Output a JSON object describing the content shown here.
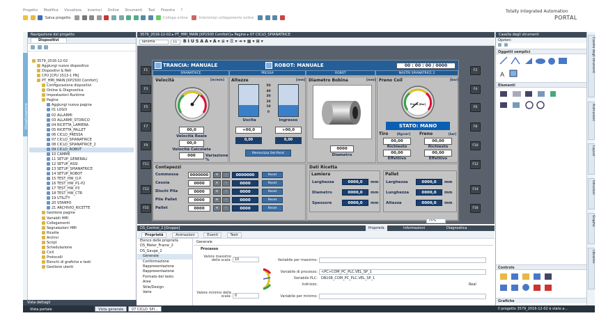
{
  "menubar": [
    "Progetto",
    "Modifica",
    "Visualizza",
    "Inserisci",
    "Online",
    "Strumenti",
    "Tool",
    "Finestra",
    "?"
  ],
  "brand": {
    "line1": "Totally Integrated Automation",
    "line2": "PORTAL"
  },
  "toolbar": {
    "save": "Salva progetto",
    "go_online": "Collega online",
    "go_offline": "Interrompi collegamento online"
  },
  "project_nav": {
    "header": "Navigazione del progetto",
    "tab": "Dispositivi",
    "items": [
      {
        "label": "3579_2016-12-02",
        "level": 0
      },
      {
        "label": "Aggiungi nuovo dispositivo",
        "level": 1
      },
      {
        "label": "Dispositivi & Reti",
        "level": 1
      },
      {
        "label": "CPU [CPU 1513-1 PN]",
        "level": 1
      },
      {
        "label": "PT_HMI_MAIN [KP1500 Comfort]",
        "level": 1
      },
      {
        "label": "Configurazione dispositivi",
        "level": 2
      },
      {
        "label": "Online & Diagnostica",
        "level": 2
      },
      {
        "label": "Impostazioni Runtime",
        "level": 2
      },
      {
        "label": "Pagine",
        "level": 2
      },
      {
        "label": "Aggiungi nuova pagina",
        "level": 3
      },
      {
        "label": "01 LOGO",
        "level": 3
      },
      {
        "label": "02 ALLARMI",
        "level": 3
      },
      {
        "label": "03 ALLARMI_STORICO",
        "level": 3
      },
      {
        "label": "04 RICETTA_LAMIERA",
        "level": 3
      },
      {
        "label": "05 RICETTA_PALLET",
        "level": 3
      },
      {
        "label": "06 CICLO_PRESSA",
        "level": 3
      },
      {
        "label": "07 CICLO_SPIANATRICE",
        "level": 3
      },
      {
        "label": "08 CICLO_SPIANATRICE_2",
        "level": 3
      },
      {
        "label": "09 CICLO_ROBOT",
        "level": 3
      },
      {
        "label": "10 CAMME",
        "level": 3
      },
      {
        "label": "11 SETUP_GENERALI",
        "level": 3
      },
      {
        "label": "12 SETUP_ASSI",
        "level": 3
      },
      {
        "label": "13 SETUP_SPIANATRICE",
        "level": 3
      },
      {
        "label": "14 SETUP_ROBOT",
        "level": 3
      },
      {
        "label": "15 TEST_HW_O.P.",
        "level": 3
      },
      {
        "label": "16 TEST_HW_P1-P2",
        "level": 3
      },
      {
        "label": "17 TEST_HW_P3",
        "level": 3
      },
      {
        "label": "18 TEST_HW_CTR",
        "level": 3
      },
      {
        "label": "19 UTILITY",
        "level": 3
      },
      {
        "label": "20 STAMPO",
        "level": 3
      },
      {
        "label": "21 ARCHIVIO_RICETTE",
        "level": 3
      },
      {
        "label": "Gestione pagine",
        "level": 2
      },
      {
        "label": "Variabili HMI",
        "level": 2
      },
      {
        "label": "Collegamenti",
        "level": 2
      },
      {
        "label": "Segnalazioni HMI",
        "level": 2
      },
      {
        "label": "Ricette",
        "level": 2
      },
      {
        "label": "Archivi",
        "level": 2
      },
      {
        "label": "Script",
        "level": 2
      },
      {
        "label": "Schedulazione",
        "level": 2
      },
      {
        "label": "Cicli",
        "level": 2
      },
      {
        "label": "Protocolli",
        "level": 2
      },
      {
        "label": "Elenchi di grafiche e testi",
        "level": 2
      },
      {
        "label": "Gestione utenti",
        "level": 2
      }
    ],
    "selected_index": 18,
    "details_view": "Vista dettagli",
    "left_strip_label": "Visualizzazione"
  },
  "editor": {
    "breadcrumb": "3579_2016-12-02 ▸ PT_HMI_MAIN [KP1500 Comfort] ▸ Pagine ▸ 07 CICLO_SPIANATRICE",
    "font": "Tahoma",
    "font_size": "11",
    "zoom": "75%"
  },
  "hmi": {
    "title_left": "TRANCIA: MANUALE",
    "title_right": "ROBOT: MANUALE",
    "time": "00 : 00 : 00 / 0000",
    "nav": [
      "SPIANATRICE",
      "PRESSA",
      "ROBOT",
      "NASTRI SPIANATRICE 2"
    ],
    "fkeys_left": [
      "F1",
      "F2",
      "F3",
      "F4",
      "F5",
      "F6",
      "F7",
      "F8"
    ],
    "fkeys_left2": [
      "F9",
      "F11",
      "F13",
      "F15"
    ],
    "fkeys_right": [
      "F2",
      "F4",
      "F6",
      "F8",
      "F10",
      "F12",
      "F14",
      "F16"
    ],
    "velocita": {
      "title": "Velocità",
      "unit": "[m/min]",
      "reale_val": "00,0",
      "reale_lbl": "Velocità Reale",
      "calc_val": "00,0",
      "calc_lbl": "Velocità Calcolata",
      "var_val": "000",
      "var_lbl": "Variazione %"
    },
    "altezze": {
      "title": "Altezze",
      "unit": "[mm]",
      "uscita_val": "+00,0",
      "uscita_lbl": "Uscita",
      "ingresso_val": "+00,0",
      "ingresso_lbl": "Ingresso",
      "v1": "0,00",
      "v2": "0,00",
      "ticks": [
        "50",
        "40",
        "30",
        "20",
        "10",
        "0"
      ],
      "btn": "Memorizza Set-Point"
    },
    "bobina": {
      "title": "Diametro Bobina",
      "unit": "[mm]",
      "val": "0000",
      "lbl": "Diametro"
    },
    "freno": {
      "title": "Freno Coil",
      "unit": "[bar]",
      "gauge_lbl": "Freno [Bar]",
      "stato": "STATO: MANO",
      "tiro": "Tiro",
      "tiro_unit": "[Kg/cm²]",
      "freno2": "Freno",
      "freno2_unit": "[bar]",
      "v1": "00,00",
      "l1": "Richiesto",
      "v2": "00,00",
      "l2": "Richiesto",
      "v3": "00,00",
      "l3": "Effettivo",
      "v4": "00,00",
      "l4": "Effettivo"
    },
    "contapezzi": {
      "title": "Contapezzi",
      "rows": [
        {
          "label": "Commessa",
          "value": "0000000",
          "value2": "0000000",
          "reset": "Reset"
        },
        {
          "label": "Cesoia",
          "value": "0000",
          "value2": "0000",
          "reset": "Reset"
        },
        {
          "label": "Dischi Pila",
          "value": "0000",
          "value2": "0000",
          "reset": "Reset"
        },
        {
          "label": "Pile Pallet",
          "value": "0000",
          "value2": "0000",
          "reset": "Reset"
        },
        {
          "label": "Pallet",
          "value": "0000",
          "value2": "0000",
          "reset": "Reset"
        }
      ]
    },
    "ricetta": {
      "title": "Dati Ricetta",
      "lamiera": "Lamiera",
      "pallet": "Pallet",
      "lam_rows": [
        {
          "label": "Larghezza",
          "value": "0000,0",
          "unit": "mm"
        },
        {
          "label": "Diametro",
          "value": "0000,0",
          "unit": "mm"
        },
        {
          "label": "Spessore",
          "value": "0000,0",
          "unit": "mm"
        }
      ],
      "pal_rows": [
        {
          "label": "Larghezza",
          "value": "0000,0",
          "unit": "mm"
        },
        {
          "label": "Lunghezza",
          "value": "0000,0",
          "unit": "mm"
        },
        {
          "label": "Altezza",
          "value": "0000,0",
          "unit": "mm"
        }
      ]
    }
  },
  "inspector": {
    "header": "DS_Control_2 [Gruppo]",
    "right_tabs": [
      "Proprietà",
      "Informazioni",
      "Diagnostica"
    ],
    "tabs": [
      "Proprietà",
      "Animazioni",
      "Eventi",
      "Testi"
    ],
    "nav": [
      "Elenco delle proprietà",
      "DS_Meter_Frame_2",
      "DS_Gauge_2",
      "Generale",
      "Conformazione",
      "Rappresentazione",
      "Rappresentazione",
      "Formato del testo",
      "Aree",
      "Stile/Design",
      "Varie"
    ],
    "nav_selected": 3,
    "section": "Generale",
    "subsection": "Processo",
    "val_max_lbl": "Valore massimo della scala:",
    "val_max": "10",
    "val_min_lbl": "Valore minimo della scala:",
    "val_min": "0",
    "var_max_lbl": "Variabile per massimo:",
    "var_proc_lbl": "Variabile di processo:",
    "var_proc": "<PC>COM_PC_PLC.VEL_SP_1",
    "var_plc_lbl": "Variabile PLC:",
    "var_plc": "DB108_COM_PC_PLC.VEL_SP_1",
    "indirizzo_lbl": "Indirizzo:",
    "indirizzo": "Real",
    "var_min_lbl": "Variabile per minimo:"
  },
  "toolbox": {
    "header": "Casella degli strumenti",
    "options": "Opzioni",
    "simple": "Oggetti semplici",
    "elements": "Elementi",
    "controls": "Controls",
    "graphics": "Grafiche",
    "right_tabs": [
      "Casella degli strumenti",
      "Animazioni",
      "Layout",
      "Istruzioni",
      "Graphic",
      "Libraries"
    ]
  },
  "statusbar": {
    "portal": "Vista portale",
    "tab1": "Vista generale",
    "tab2": "07 CICLO_SPI...",
    "msg": "Il progetto 3579_2016-12-02 è stato a..."
  }
}
